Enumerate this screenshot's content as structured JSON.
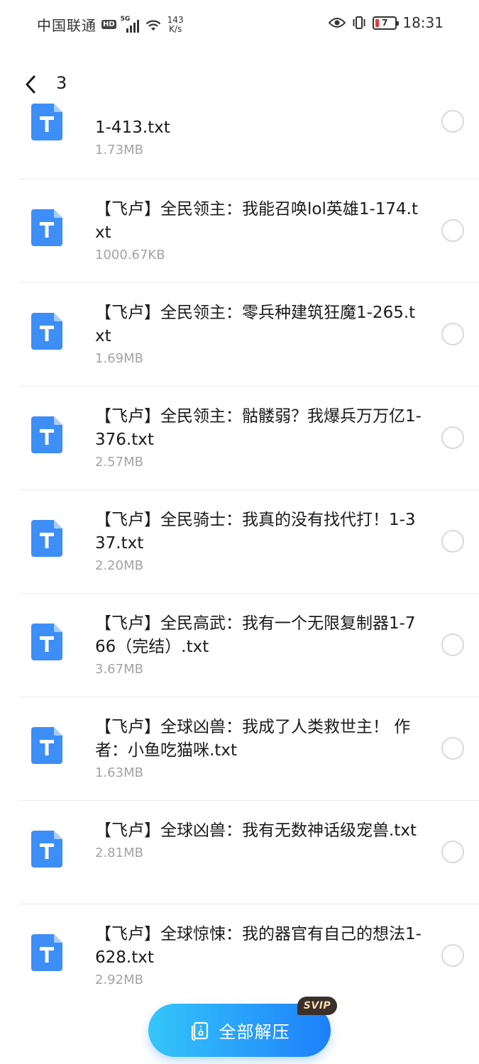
{
  "status_bar": {
    "carrier": "中国联通",
    "hd": "HD",
    "network": "5G",
    "speed_value": "143",
    "speed_unit": "K/s",
    "battery": "7",
    "time": "18:31"
  },
  "header": {
    "title": "3"
  },
  "files": [
    {
      "name": "1-413.txt",
      "size": "1.73MB"
    },
    {
      "name": "【飞卢】全民领主：我能召唤lol英雄1-174.txt",
      "size": "1000.67KB"
    },
    {
      "name": "【飞卢】全民领主：零兵种建筑狂魔1-265.txt",
      "size": "1.69MB"
    },
    {
      "name": "【飞卢】全民领主：骷髅弱？我爆兵万万亿1-376.txt",
      "size": "2.57MB"
    },
    {
      "name": "【飞卢】全民骑士：我真的没有找代打！1-337.txt",
      "size": "2.20MB"
    },
    {
      "name": "【飞卢】全民高武：我有一个无限复制器1-766（完结）.txt",
      "size": "3.67MB"
    },
    {
      "name": "【飞卢】全球凶兽：我成了人类救世主！ 作者：小鱼吃猫咪.txt",
      "size": "1.63MB"
    },
    {
      "name": "【飞卢】全球凶兽：我有无数神话级宠兽.txt",
      "size": "2.81MB"
    },
    {
      "name": "【飞卢】全球惊悚：我的器官有自己的想法1-628.txt",
      "size": "2.92MB"
    }
  ],
  "footer": {
    "extract_all_label": "全部解压",
    "svip_badge": "SVIP"
  },
  "colors": {
    "accent_start": "#34c6f9",
    "accent_end": "#1e7ffb",
    "file_icon": "#3d8ef7",
    "battery_low": "#e53935"
  }
}
